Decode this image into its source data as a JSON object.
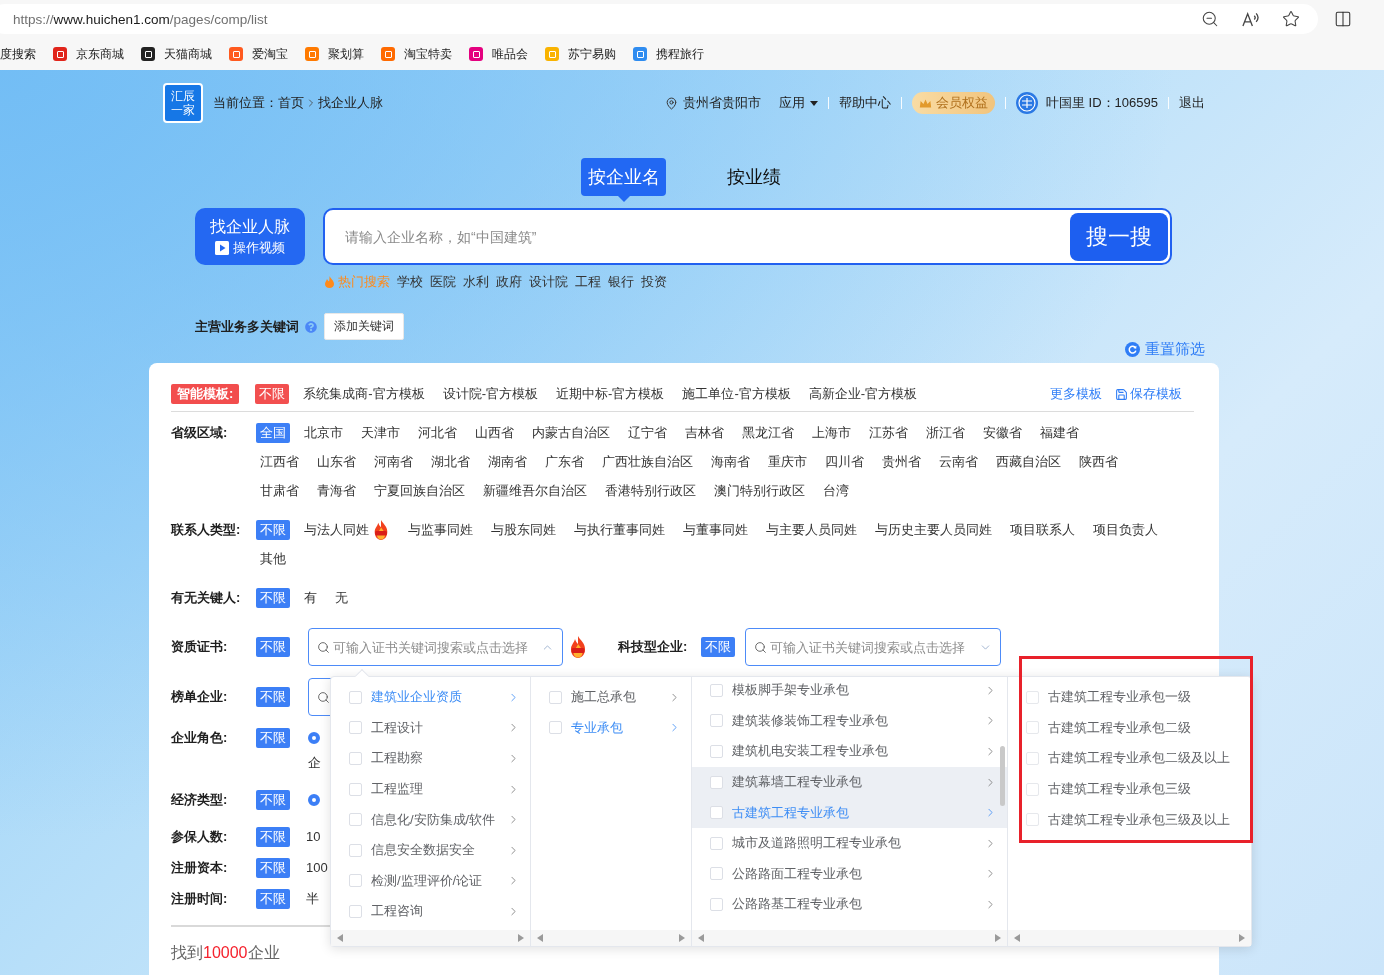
{
  "browser": {
    "url": {
      "scheme": "https://",
      "host": "www.huichen1.com",
      "path": "/pages/comp/list"
    },
    "bookmarks": [
      {
        "label": "度搜索"
      },
      {
        "label": "京东商城",
        "color": "#e1251b"
      },
      {
        "label": "天猫商城",
        "color": "#222222"
      },
      {
        "label": "爱淘宝",
        "color": "#ff5a1f"
      },
      {
        "label": "聚划算",
        "color": "#ff7a00"
      },
      {
        "label": "淘宝特卖",
        "color": "#ff6a00"
      },
      {
        "label": "唯品会",
        "color": "#e4007f"
      },
      {
        "label": "苏宁易购",
        "color": "#f9b300"
      },
      {
        "label": "携程旅行",
        "color": "#2f8cf0"
      }
    ]
  },
  "header": {
    "logo": [
      "汇辰",
      "一家"
    ],
    "breadcrumb": {
      "prefix": "当前位置：",
      "items": [
        "首页",
        "找企业人脉"
      ]
    },
    "location": "贵州省贵阳市",
    "apps": "应用",
    "help": "帮助中心",
    "member": "会员权益",
    "user": "叶国里 ID：106595",
    "logout": "退出"
  },
  "search_tabs": [
    {
      "label": "按企业名",
      "selected": true
    },
    {
      "label": "按业绩",
      "selected": false
    }
  ],
  "guide_button": {
    "title": "找企业人脉",
    "video": "操作视频"
  },
  "search": {
    "placeholder": "请输入企业名称，如“中国建筑”",
    "button": "搜一搜"
  },
  "hot_search": {
    "label": "热门搜索",
    "words": [
      "学校",
      "医院",
      "水利",
      "政府",
      "设计院",
      "工程",
      "银行",
      "投资"
    ]
  },
  "keywords": {
    "label": "主营业务多关键词",
    "button": "添加关键词"
  },
  "reset": "重置筛选",
  "templates": {
    "label": "智能模板:",
    "options": [
      {
        "label": "不限",
        "selected": true
      },
      {
        "label": "系统集成商-官方模板",
        "selected": false
      },
      {
        "label": "设计院-官方模板",
        "selected": false
      },
      {
        "label": "近期中标-官方模板",
        "selected": false
      },
      {
        "label": "施工单位-官方模板",
        "selected": false
      },
      {
        "label": "高新企业-官方模板",
        "selected": false
      }
    ],
    "more": "更多模板",
    "save": "保存模板"
  },
  "filters": [
    {
      "kind": "options",
      "label": "省级区域:",
      "lines": [
        [
          {
            "label": "全国",
            "selected": true
          },
          {
            "label": "北京市",
            "selected": false
          },
          {
            "label": "天津市",
            "selected": false
          },
          {
            "label": "河北省",
            "selected": false
          },
          {
            "label": "山西省",
            "selected": false
          },
          {
            "label": "内蒙古自治区",
            "selected": false
          },
          {
            "label": "辽宁省",
            "selected": false
          },
          {
            "label": "吉林省",
            "selected": false
          },
          {
            "label": "黑龙江省",
            "selected": false
          },
          {
            "label": "上海市",
            "selected": false
          },
          {
            "label": "江苏省",
            "selected": false
          },
          {
            "label": "浙江省",
            "selected": false
          },
          {
            "label": "安徽省",
            "selected": false
          },
          {
            "label": "福建省",
            "selected": false
          }
        ],
        [
          {
            "label": "江西省",
            "selected": false
          },
          {
            "label": "山东省",
            "selected": false
          },
          {
            "label": "河南省",
            "selected": false
          },
          {
            "label": "湖北省",
            "selected": false
          },
          {
            "label": "湖南省",
            "selected": false
          },
          {
            "label": "广东省",
            "selected": false
          },
          {
            "label": "广西壮族自治区",
            "selected": false
          },
          {
            "label": "海南省",
            "selected": false
          },
          {
            "label": "重庆市",
            "selected": false
          },
          {
            "label": "四川省",
            "selected": false
          },
          {
            "label": "贵州省",
            "selected": false
          },
          {
            "label": "云南省",
            "selected": false
          },
          {
            "label": "西藏自治区",
            "selected": false
          },
          {
            "label": "陕西省",
            "selected": false
          }
        ],
        [
          {
            "label": "甘肃省",
            "selected": false
          },
          {
            "label": "青海省",
            "selected": false
          },
          {
            "label": "宁夏回族自治区",
            "selected": false
          },
          {
            "label": "新疆维吾尔自治区",
            "selected": false
          },
          {
            "label": "香港特别行政区",
            "selected": false
          },
          {
            "label": "澳门特别行政区",
            "selected": false
          },
          {
            "label": "台湾",
            "selected": false
          }
        ]
      ]
    },
    {
      "kind": "options",
      "label": "联系人类型:",
      "lines": [
        [
          {
            "label": "不限",
            "selected": true,
            "hot": false
          },
          {
            "label": "与法人同姓",
            "selected": false,
            "hot": true
          },
          {
            "label": "与监事同姓",
            "selected": false,
            "hot": false
          },
          {
            "label": "与股东同姓",
            "selected": false,
            "hot": false
          },
          {
            "label": "与执行董事同姓",
            "selected": false,
            "hot": false
          },
          {
            "label": "与董事同姓",
            "selected": false,
            "hot": false
          },
          {
            "label": "与主要人员同姓",
            "selected": false,
            "hot": false
          },
          {
            "label": "与历史主要人员同姓",
            "selected": false,
            "hot": false
          },
          {
            "label": "项目联系人",
            "selected": false,
            "hot": false
          },
          {
            "label": "项目负责人",
            "selected": false,
            "hot": false
          }
        ],
        [
          {
            "label": "其他",
            "selected": false,
            "hot": false
          }
        ]
      ]
    },
    {
      "kind": "options",
      "label": "有无关键人:",
      "lines": [
        [
          {
            "label": "不限",
            "selected": true
          },
          {
            "label": "有",
            "selected": false
          },
          {
            "label": "无",
            "selected": false
          }
        ]
      ]
    },
    {
      "kind": "select",
      "label": "资质证书:",
      "all": {
        "label": "不限",
        "selected": true
      },
      "hot": true,
      "select": {
        "placeholder": "可输入证书关键词搜索或点击选择",
        "open": true,
        "cascader": {
          "columns": [
            {
              "scrollbar": false,
              "items": [
                {
                  "label": "建筑业企业资质",
                  "checked": false,
                  "selected": true,
                  "highlighted": false,
                  "has_children": true
                },
                {
                  "label": "工程设计",
                  "checked": false,
                  "selected": false,
                  "highlighted": false,
                  "has_children": true
                },
                {
                  "label": "工程勘察",
                  "checked": false,
                  "selected": false,
                  "highlighted": false,
                  "has_children": true
                },
                {
                  "label": "工程监理",
                  "checked": false,
                  "selected": false,
                  "highlighted": false,
                  "has_children": true
                },
                {
                  "label": "信息化/安防集成/软件",
                  "checked": false,
                  "selected": false,
                  "highlighted": false,
                  "has_children": true
                },
                {
                  "label": "信息安全数据安全",
                  "checked": false,
                  "selected": false,
                  "highlighted": false,
                  "has_children": true
                },
                {
                  "label": "检测/监理评价/论证",
                  "checked": false,
                  "selected": false,
                  "highlighted": false,
                  "has_children": true
                },
                {
                  "label": "工程咨询",
                  "checked": false,
                  "selected": false,
                  "highlighted": false,
                  "has_children": true
                }
              ]
            },
            {
              "scrollbar": false,
              "items": [
                {
                  "label": "施工总承包",
                  "checked": false,
                  "selected": false,
                  "highlighted": false,
                  "has_children": true
                },
                {
                  "label": "专业承包",
                  "checked": false,
                  "selected": true,
                  "highlighted": false,
                  "has_children": true
                }
              ]
            },
            {
              "scrollbar": true,
              "items": [
                {
                  "label": "模板脚手架专业承包",
                  "checked": false,
                  "selected": false,
                  "highlighted": false,
                  "has_children": true
                },
                {
                  "label": "建筑装修装饰工程专业承包",
                  "checked": false,
                  "selected": false,
                  "highlighted": false,
                  "has_children": true
                },
                {
                  "label": "建筑机电安装工程专业承包",
                  "checked": false,
                  "selected": false,
                  "highlighted": false,
                  "has_children": true
                },
                {
                  "label": "建筑幕墙工程专业承包",
                  "checked": false,
                  "selected": false,
                  "highlighted": true,
                  "has_children": true
                },
                {
                  "label": "古建筑工程专业承包",
                  "checked": false,
                  "selected": true,
                  "highlighted": true,
                  "has_children": true
                },
                {
                  "label": "城市及道路照明工程专业承包",
                  "checked": false,
                  "selected": false,
                  "highlighted": false,
                  "has_children": true
                },
                {
                  "label": "公路路面工程专业承包",
                  "checked": false,
                  "selected": false,
                  "highlighted": false,
                  "has_children": true
                },
                {
                  "label": "公路路基工程专业承包",
                  "checked": false,
                  "selected": false,
                  "highlighted": false,
                  "has_children": true
                }
              ]
            },
            {
              "scrollbar": false,
              "items": [
                {
                  "label": "古建筑工程专业承包一级",
                  "checked": false,
                  "selected": false,
                  "highlighted": false,
                  "has_children": false
                },
                {
                  "label": "古建筑工程专业承包二级",
                  "checked": false,
                  "selected": false,
                  "highlighted": false,
                  "has_children": false
                },
                {
                  "label": "古建筑工程专业承包二级及以上",
                  "checked": false,
                  "selected": false,
                  "highlighted": false,
                  "has_children": false
                },
                {
                  "label": "古建筑工程专业承包三级",
                  "checked": false,
                  "selected": false,
                  "highlighted": false,
                  "has_children": false
                },
                {
                  "label": "古建筑工程专业承包三级及以上",
                  "checked": false,
                  "selected": false,
                  "highlighted": false,
                  "has_children": false
                }
              ]
            }
          ]
        }
      },
      "extra": {
        "label": "科技型企业:",
        "all": {
          "label": "不限",
          "selected": true
        },
        "select": {
          "placeholder": "可输入证书关键词搜索或点击选择",
          "open": false
        }
      }
    },
    {
      "kind": "select",
      "label": "榜单企业:",
      "all": {
        "label": "不限",
        "selected": true
      }
    },
    {
      "kind": "radio",
      "label": "企业角色:",
      "all": {
        "label": "不限",
        "selected": true
      },
      "radio": {
        "checked": true
      },
      "text": "企"
    },
    {
      "kind": "radio",
      "label": "经济类型:",
      "all": {
        "label": "不限",
        "selected": true
      },
      "radio": {
        "checked": true
      }
    },
    {
      "kind": "range",
      "label": "参保人数:",
      "all": {
        "label": "不限",
        "selected": true
      },
      "text": "10"
    },
    {
      "kind": "range",
      "label": "注册资本:",
      "all": {
        "label": "不限",
        "selected": true
      },
      "text": "100"
    },
    {
      "kind": "range",
      "label": "注册时间:",
      "all": {
        "label": "不限",
        "selected": true
      },
      "text": "半"
    }
  ],
  "results": {
    "prefix": "找到",
    "count": "10000",
    "suffix": "企业"
  }
}
